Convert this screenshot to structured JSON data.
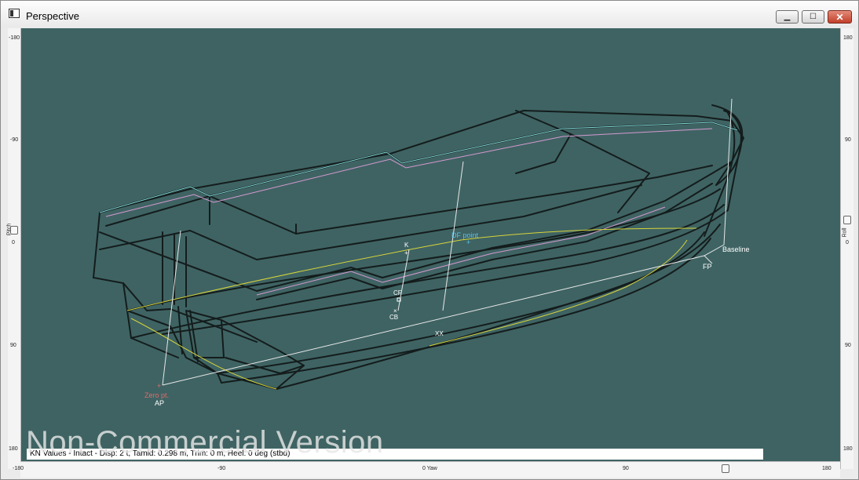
{
  "window": {
    "title": "Perspective",
    "minimize_glyph": "▁",
    "maximize_glyph": "☐",
    "close_glyph": "✕"
  },
  "rulers": {
    "left": {
      "ticks": [
        "-180",
        "-90",
        "0",
        "90",
        "180"
      ],
      "label": "Pitch"
    },
    "right": {
      "ticks": [
        "180",
        "90",
        "0",
        "90",
        "180"
      ],
      "label": "Roll"
    },
    "bottom": {
      "ticks": [
        "-180",
        "-90",
        "0 Yaw",
        "90",
        "180"
      ]
    }
  },
  "viewport": {
    "background_color": "#3f6363",
    "labels": {
      "df_point": "DF point",
      "k": "K",
      "cf": "CF",
      "cb": "CB",
      "g_marker": "XX",
      "baseline": "Baseline",
      "fp": "FP",
      "zero_pt": "Zero pt.",
      "ap": "AP"
    }
  },
  "status": {
    "text": "KN Values - Intact - Disp: 2 t, Tamid: 0.298 m, Trim: 0 m, Heel: 0 deg (stbd)"
  },
  "watermark": "Non-Commercial Version"
}
